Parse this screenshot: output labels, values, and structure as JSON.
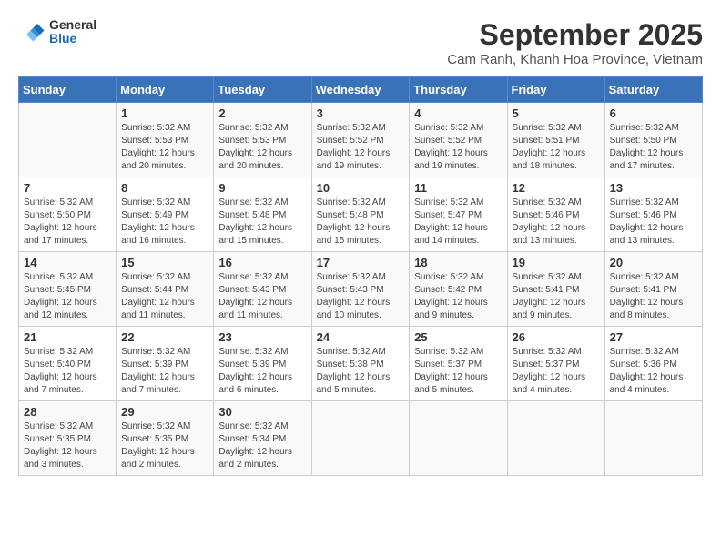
{
  "header": {
    "logo_general": "General",
    "logo_blue": "Blue",
    "month_title": "September 2025",
    "subtitle": "Cam Ranh, Khanh Hoa Province, Vietnam"
  },
  "days_of_week": [
    "Sunday",
    "Monday",
    "Tuesday",
    "Wednesday",
    "Thursday",
    "Friday",
    "Saturday"
  ],
  "weeks": [
    [
      {
        "day": "",
        "info": ""
      },
      {
        "day": "1",
        "info": "Sunrise: 5:32 AM\nSunset: 5:53 PM\nDaylight: 12 hours\nand 20 minutes."
      },
      {
        "day": "2",
        "info": "Sunrise: 5:32 AM\nSunset: 5:53 PM\nDaylight: 12 hours\nand 20 minutes."
      },
      {
        "day": "3",
        "info": "Sunrise: 5:32 AM\nSunset: 5:52 PM\nDaylight: 12 hours\nand 19 minutes."
      },
      {
        "day": "4",
        "info": "Sunrise: 5:32 AM\nSunset: 5:52 PM\nDaylight: 12 hours\nand 19 minutes."
      },
      {
        "day": "5",
        "info": "Sunrise: 5:32 AM\nSunset: 5:51 PM\nDaylight: 12 hours\nand 18 minutes."
      },
      {
        "day": "6",
        "info": "Sunrise: 5:32 AM\nSunset: 5:50 PM\nDaylight: 12 hours\nand 17 minutes."
      }
    ],
    [
      {
        "day": "7",
        "info": "Sunrise: 5:32 AM\nSunset: 5:50 PM\nDaylight: 12 hours\nand 17 minutes."
      },
      {
        "day": "8",
        "info": "Sunrise: 5:32 AM\nSunset: 5:49 PM\nDaylight: 12 hours\nand 16 minutes."
      },
      {
        "day": "9",
        "info": "Sunrise: 5:32 AM\nSunset: 5:48 PM\nDaylight: 12 hours\nand 15 minutes."
      },
      {
        "day": "10",
        "info": "Sunrise: 5:32 AM\nSunset: 5:48 PM\nDaylight: 12 hours\nand 15 minutes."
      },
      {
        "day": "11",
        "info": "Sunrise: 5:32 AM\nSunset: 5:47 PM\nDaylight: 12 hours\nand 14 minutes."
      },
      {
        "day": "12",
        "info": "Sunrise: 5:32 AM\nSunset: 5:46 PM\nDaylight: 12 hours\nand 13 minutes."
      },
      {
        "day": "13",
        "info": "Sunrise: 5:32 AM\nSunset: 5:46 PM\nDaylight: 12 hours\nand 13 minutes."
      }
    ],
    [
      {
        "day": "14",
        "info": "Sunrise: 5:32 AM\nSunset: 5:45 PM\nDaylight: 12 hours\nand 12 minutes."
      },
      {
        "day": "15",
        "info": "Sunrise: 5:32 AM\nSunset: 5:44 PM\nDaylight: 12 hours\nand 11 minutes."
      },
      {
        "day": "16",
        "info": "Sunrise: 5:32 AM\nSunset: 5:43 PM\nDaylight: 12 hours\nand 11 minutes."
      },
      {
        "day": "17",
        "info": "Sunrise: 5:32 AM\nSunset: 5:43 PM\nDaylight: 12 hours\nand 10 minutes."
      },
      {
        "day": "18",
        "info": "Sunrise: 5:32 AM\nSunset: 5:42 PM\nDaylight: 12 hours\nand 9 minutes."
      },
      {
        "day": "19",
        "info": "Sunrise: 5:32 AM\nSunset: 5:41 PM\nDaylight: 12 hours\nand 9 minutes."
      },
      {
        "day": "20",
        "info": "Sunrise: 5:32 AM\nSunset: 5:41 PM\nDaylight: 12 hours\nand 8 minutes."
      }
    ],
    [
      {
        "day": "21",
        "info": "Sunrise: 5:32 AM\nSunset: 5:40 PM\nDaylight: 12 hours\nand 7 minutes."
      },
      {
        "day": "22",
        "info": "Sunrise: 5:32 AM\nSunset: 5:39 PM\nDaylight: 12 hours\nand 7 minutes."
      },
      {
        "day": "23",
        "info": "Sunrise: 5:32 AM\nSunset: 5:39 PM\nDaylight: 12 hours\nand 6 minutes."
      },
      {
        "day": "24",
        "info": "Sunrise: 5:32 AM\nSunset: 5:38 PM\nDaylight: 12 hours\nand 5 minutes."
      },
      {
        "day": "25",
        "info": "Sunrise: 5:32 AM\nSunset: 5:37 PM\nDaylight: 12 hours\nand 5 minutes."
      },
      {
        "day": "26",
        "info": "Sunrise: 5:32 AM\nSunset: 5:37 PM\nDaylight: 12 hours\nand 4 minutes."
      },
      {
        "day": "27",
        "info": "Sunrise: 5:32 AM\nSunset: 5:36 PM\nDaylight: 12 hours\nand 4 minutes."
      }
    ],
    [
      {
        "day": "28",
        "info": "Sunrise: 5:32 AM\nSunset: 5:35 PM\nDaylight: 12 hours\nand 3 minutes."
      },
      {
        "day": "29",
        "info": "Sunrise: 5:32 AM\nSunset: 5:35 PM\nDaylight: 12 hours\nand 2 minutes."
      },
      {
        "day": "30",
        "info": "Sunrise: 5:32 AM\nSunset: 5:34 PM\nDaylight: 12 hours\nand 2 minutes."
      },
      {
        "day": "",
        "info": ""
      },
      {
        "day": "",
        "info": ""
      },
      {
        "day": "",
        "info": ""
      },
      {
        "day": "",
        "info": ""
      }
    ]
  ]
}
